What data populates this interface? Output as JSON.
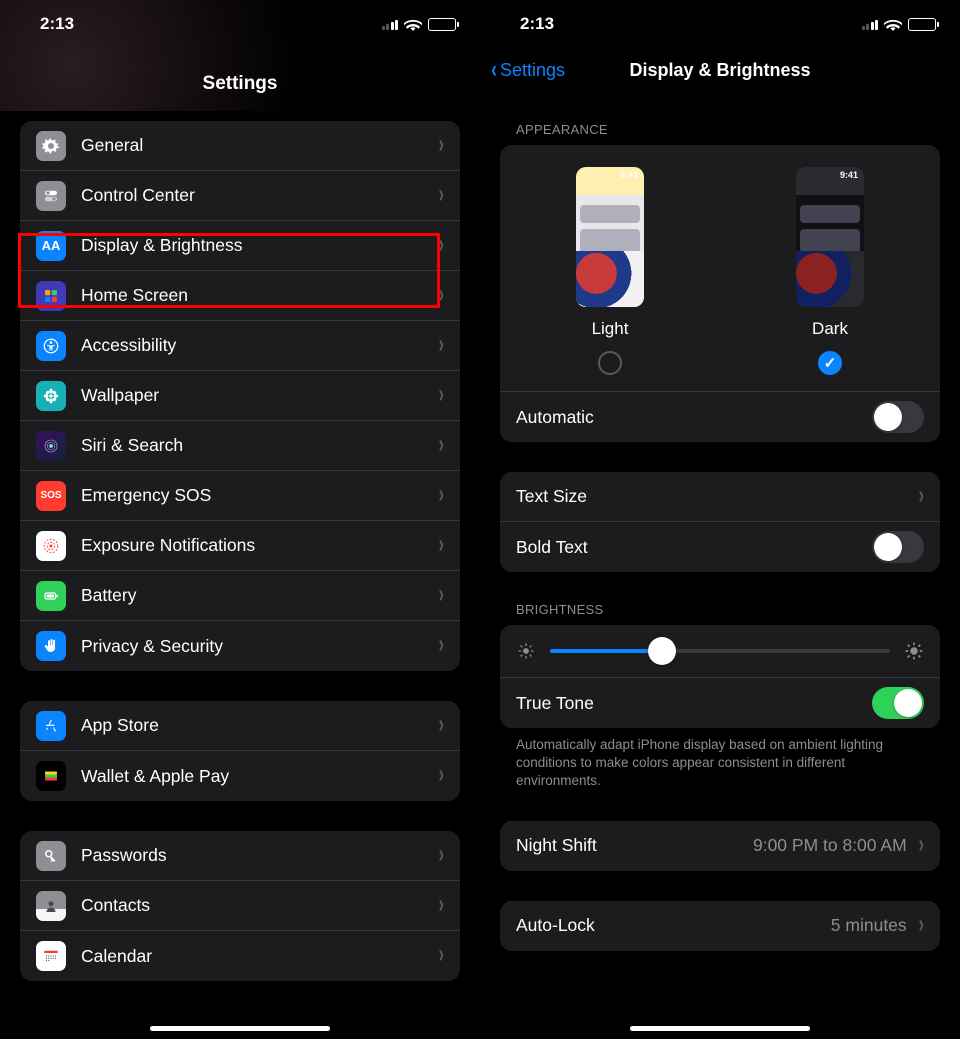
{
  "status": {
    "time": "2:13"
  },
  "left": {
    "title": "Settings",
    "groups": [
      [
        {
          "icon": "gear",
          "bg": "ic-gen",
          "label": "General"
        },
        {
          "icon": "switches",
          "bg": "ic-cc",
          "label": "Control Center"
        },
        {
          "icon": "aa",
          "bg": "ic-db",
          "label": "Display & Brightness"
        },
        {
          "icon": "grid",
          "bg": "ic-hs",
          "label": "Home Screen"
        },
        {
          "icon": "person",
          "bg": "ic-acc",
          "label": "Accessibility"
        },
        {
          "icon": "flower",
          "bg": "ic-wall",
          "label": "Wallpaper"
        },
        {
          "icon": "siri",
          "bg": "ic-siri",
          "label": "Siri & Search"
        },
        {
          "icon": "sos",
          "bg": "ic-sos",
          "label": "Emergency SOS"
        },
        {
          "icon": "dots",
          "bg": "ic-exp",
          "label": "Exposure Notifications"
        },
        {
          "icon": "batt",
          "bg": "ic-batt",
          "label": "Battery"
        },
        {
          "icon": "hand",
          "bg": "ic-priv",
          "label": "Privacy & Security"
        }
      ],
      [
        {
          "icon": "appstore",
          "bg": "ic-as",
          "label": "App Store"
        },
        {
          "icon": "wallet",
          "bg": "ic-wal",
          "label": "Wallet & Apple Pay"
        }
      ],
      [
        {
          "icon": "key",
          "bg": "ic-pw",
          "label": "Passwords"
        },
        {
          "icon": "contact",
          "bg": "ic-con",
          "label": "Contacts"
        },
        {
          "icon": "cal",
          "bg": "ic-cal",
          "label": "Calendar"
        }
      ]
    ]
  },
  "right": {
    "back": "Settings",
    "title": "Display & Brightness",
    "appearance": {
      "header": "APPEARANCE",
      "options": {
        "light": "Light",
        "dark": "Dark",
        "selected": "dark",
        "mock_time": "9:41"
      },
      "automatic": {
        "label": "Automatic",
        "on": false
      }
    },
    "text": {
      "size_label": "Text Size",
      "bold_label": "Bold Text",
      "bold_on": false
    },
    "brightness": {
      "header": "BRIGHTNESS",
      "value_pct": 33,
      "truetone": {
        "label": "True Tone",
        "on": true
      },
      "footer": "Automatically adapt iPhone display based on ambient lighting conditions to make colors appear consistent in different environments."
    },
    "nightshift": {
      "label": "Night Shift",
      "detail": "9:00 PM to 8:00 AM"
    },
    "autolock": {
      "label": "Auto-Lock",
      "detail": "5 minutes"
    }
  }
}
